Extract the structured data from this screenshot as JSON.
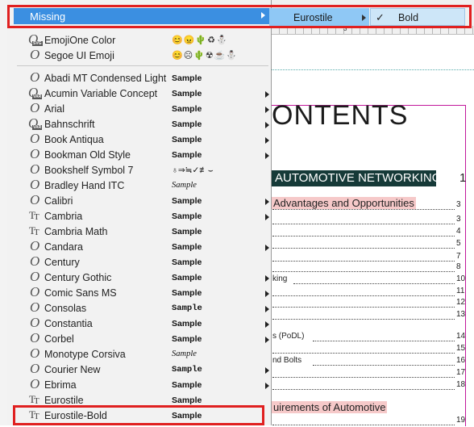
{
  "menu": {
    "missing_label": "Missing",
    "items_top": [
      {
        "name": "EmojiOne Color",
        "icon": "svg-font-icon",
        "sample": "😊😠🌵♻⛄",
        "arrow": false
      },
      {
        "name": "Segoe UI Emoji",
        "icon": "opentype-font-icon",
        "sample": "😊☹🌵☢☕⛄",
        "arrow": false
      }
    ],
    "items": [
      {
        "name": "Abadi MT Condensed Light",
        "icon": "opentype-font-icon",
        "sample": "Sample",
        "arrow": false
      },
      {
        "name": "Acumin Variable Concept",
        "icon": "variable-font-icon",
        "sample": "Sample",
        "arrow": true
      },
      {
        "name": "Arial",
        "icon": "opentype-font-icon",
        "sample": "Sample",
        "arrow": true
      },
      {
        "name": "Bahnschrift",
        "icon": "variable-font-icon",
        "sample": "Sample",
        "arrow": true
      },
      {
        "name": "Book Antiqua",
        "icon": "opentype-font-icon",
        "sample": "Sample",
        "arrow": true
      },
      {
        "name": "Bookman Old Style",
        "icon": "opentype-font-icon",
        "sample": "Sample",
        "arrow": true
      },
      {
        "name": "Bookshelf Symbol 7",
        "icon": "opentype-font-icon",
        "sample": "♁⇒≒✓≢⌣",
        "arrow": false
      },
      {
        "name": "Bradley Hand ITC",
        "icon": "opentype-font-icon",
        "sample": "Sample",
        "arrow": false
      },
      {
        "name": "Calibri",
        "icon": "opentype-font-icon",
        "sample": "Sample",
        "arrow": true
      },
      {
        "name": "Cambria",
        "icon": "truetype-font-icon",
        "sample": "Sample",
        "arrow": true
      },
      {
        "name": "Cambria Math",
        "icon": "truetype-font-icon",
        "sample": "Sample",
        "arrow": false
      },
      {
        "name": "Candara",
        "icon": "opentype-font-icon",
        "sample": "Sample",
        "arrow": true
      },
      {
        "name": "Century",
        "icon": "opentype-font-icon",
        "sample": "Sample",
        "arrow": false
      },
      {
        "name": "Century Gothic",
        "icon": "opentype-font-icon",
        "sample": "Sample",
        "arrow": true
      },
      {
        "name": "Comic Sans MS",
        "icon": "opentype-font-icon",
        "sample": "Sample",
        "arrow": true
      },
      {
        "name": "Consolas",
        "icon": "opentype-font-icon",
        "sample": "Sample",
        "arrow": true
      },
      {
        "name": "Constantia",
        "icon": "opentype-font-icon",
        "sample": "Sample",
        "arrow": true
      },
      {
        "name": "Corbel",
        "icon": "opentype-font-icon",
        "sample": "Sample",
        "arrow": true
      },
      {
        "name": "Monotype Corsiva",
        "icon": "opentype-font-icon",
        "sample": "Sample",
        "arrow": false
      },
      {
        "name": "Courier New",
        "icon": "opentype-font-icon",
        "sample": "Sample",
        "arrow": true
      },
      {
        "name": "Ebrima",
        "icon": "opentype-font-icon",
        "sample": "Sample",
        "arrow": true
      },
      {
        "name": "Eurostile",
        "icon": "truetype-font-icon",
        "sample": "Sample",
        "arrow": false
      },
      {
        "name": "Eurostile-Bold",
        "icon": "truetype-font-icon",
        "sample": "Sample",
        "arrow": false
      }
    ]
  },
  "submenu": {
    "family": "Eurostile",
    "style": "Bold"
  },
  "document": {
    "title": "ONTENTS",
    "section_heading": "AUTOMOTIVE NETWORKING",
    "section_page": "1",
    "sub_heading_1": "Advantages and Opportunities",
    "sub_heading_2": "uirements of Automotive",
    "ruler_number": "3",
    "toc": [
      {
        "text": "",
        "page": "3"
      },
      {
        "text": "",
        "page": "3"
      },
      {
        "text": "",
        "page": "4"
      },
      {
        "text": "",
        "page": "5"
      },
      {
        "text": "",
        "page": "7"
      },
      {
        "text": "",
        "page": "8"
      },
      {
        "text": "king",
        "page": "10"
      },
      {
        "text": "",
        "page": "11"
      },
      {
        "text": "",
        "page": "12"
      },
      {
        "text": "",
        "page": "13"
      },
      {
        "text": "s (PoDL)",
        "page": "14"
      },
      {
        "text": "",
        "page": "15"
      },
      {
        "text": "nd Bolts",
        "page": "16"
      },
      {
        "text": "",
        "page": "17"
      },
      {
        "text": "",
        "page": "18"
      },
      {
        "text": "",
        "page": "19"
      }
    ]
  },
  "colors": {
    "menu_bg": "#f2f2f2",
    "menu_highlight": "#3b8fe1",
    "submenu1_bg": "#8fc8f5",
    "submenu2_bg": "#cde6f8",
    "annotation_red": "#e02020",
    "section_bar": "#163a38",
    "subheading_highlight": "#f6c9c9",
    "page_border": "#c2189b"
  }
}
